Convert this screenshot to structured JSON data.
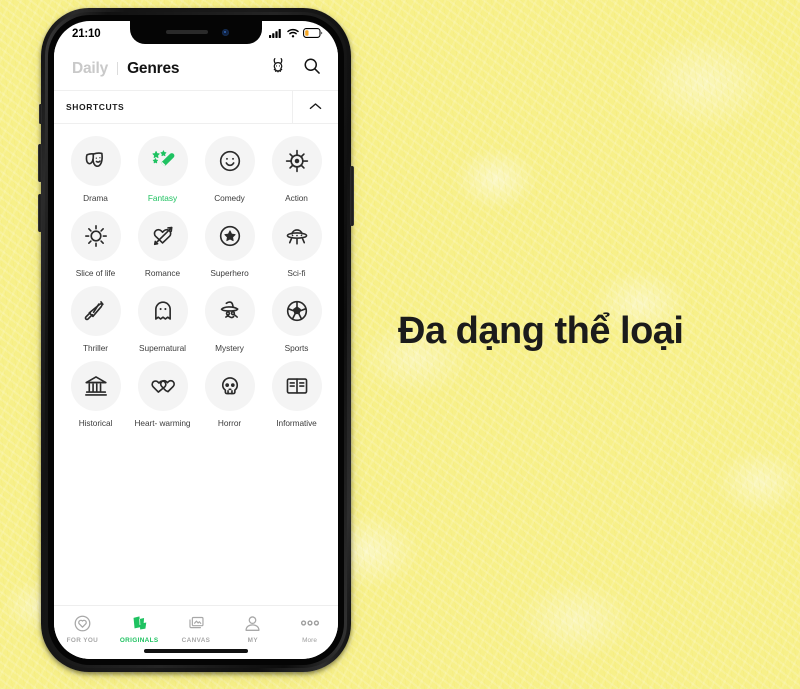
{
  "caption": "Đa dạng thể loại",
  "colors": {
    "background": "#f7f089",
    "accent_green": "#1fc261",
    "text_dark": "#1b1b1b",
    "circle_bg": "#f4f4f4",
    "inactive_gray": "#c9c9c9",
    "battery_low": "#f5a623"
  },
  "phone": {
    "status_bar": {
      "time": "21:10",
      "signal_icon": "cellular-signal-icon",
      "wifi_icon": "wifi-icon",
      "battery_icon": "battery-low-icon"
    },
    "header": {
      "tab_inactive": "Daily",
      "tab_active": "Genres",
      "rabbit_icon": "rabbit-icon",
      "search_icon": "search-icon"
    },
    "shortcuts": {
      "label": "SHORTCUTS",
      "toggle_icon": "chevron-up-icon"
    },
    "genres": [
      {
        "label": "Drama",
        "icon": "theater-masks-icon",
        "active": false
      },
      {
        "label": "Fantasy",
        "icon": "magic-wand-icon",
        "active": true
      },
      {
        "label": "Comedy",
        "icon": "smiley-face-icon",
        "active": false
      },
      {
        "label": "Action",
        "icon": "target-crosshair-icon",
        "active": false
      },
      {
        "label": "Slice of life",
        "icon": "sun-icon",
        "active": false
      },
      {
        "label": "Romance",
        "icon": "heart-arrow-icon",
        "active": false
      },
      {
        "label": "Superhero",
        "icon": "star-badge-icon",
        "active": false
      },
      {
        "label": "Sci-fi",
        "icon": "ufo-icon",
        "active": false
      },
      {
        "label": "Thriller",
        "icon": "knife-icon",
        "active": false
      },
      {
        "label": "Supernatural",
        "icon": "ghost-icon",
        "active": false
      },
      {
        "label": "Mystery",
        "icon": "detective-icon",
        "active": false
      },
      {
        "label": "Sports",
        "icon": "soccer-ball-icon",
        "active": false
      },
      {
        "label": "Historical",
        "icon": "museum-icon",
        "active": false
      },
      {
        "label": "Heart-\nwarming",
        "icon": "two-hearts-icon",
        "active": false
      },
      {
        "label": "Horror",
        "icon": "skull-icon",
        "active": false
      },
      {
        "label": "Informative",
        "icon": "open-book-icon",
        "active": false
      }
    ],
    "tabbar": [
      {
        "label": "FOR YOU",
        "icon": "heart-circle-icon",
        "active": false
      },
      {
        "label": "ORIGINALS",
        "icon": "originals-icon",
        "active": true
      },
      {
        "label": "CANVAS",
        "icon": "canvas-frames-icon",
        "active": false
      },
      {
        "label": "MY",
        "icon": "person-icon",
        "active": false
      },
      {
        "label": "More",
        "icon": "ellipsis-icon",
        "active": false
      }
    ]
  }
}
